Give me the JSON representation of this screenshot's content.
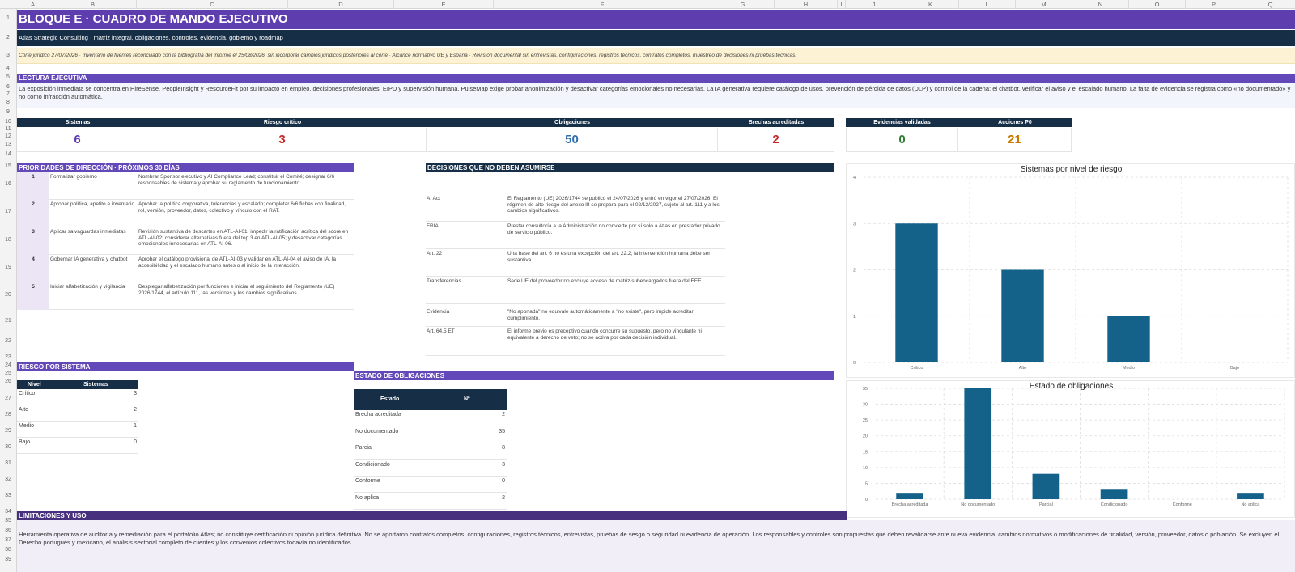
{
  "sheet": {
    "columns": [
      "A",
      "B",
      "C",
      "D",
      "E",
      "F",
      "G",
      "H",
      "I",
      "J",
      "K",
      "L",
      "M",
      "N",
      "O",
      "P",
      "Q"
    ],
    "rows": [
      "1",
      "2",
      "3",
      "4",
      "5",
      "6",
      "7",
      "8",
      "9",
      "10",
      "11",
      "12",
      "13",
      "14",
      "15",
      "16",
      "17",
      "18",
      "19",
      "20",
      "21",
      "22",
      "23",
      "24",
      "25",
      "26",
      "27",
      "28",
      "29",
      "30",
      "31",
      "32",
      "33",
      "34",
      "35",
      "36",
      "37",
      "38",
      "39"
    ]
  },
  "header": {
    "title": "BLOQUE E · CUADRO DE MANDO EJECUTIVO",
    "subtitle": "Atlas Strategic Consulting · matriz integral, obligaciones, controles, evidencia, gobierno y roadmap",
    "note": "Corte jurídico 27/07/2026 · Inventario de fuentes reconciliado con la bibliografía del informe el 25/08/2026, sin incorporar cambios jurídicos posteriores al corte · Alcance normativo UE y España · Revisión documental sin entrevistas, configuraciones, registros técnicos, contratos completos, muestreo de decisiones ni pruebas técnicas."
  },
  "lectura": {
    "title": "LECTURA EJECUTIVA",
    "text": "La exposición inmediata se concentra en HireSense, PeopleInsight y ResourceFit por su impacto en empleo, decisiones profesionales, EIPD y supervisión humana. PulseMap exige probar anonimización y desactivar categorías emocionales no necesarias. La IA generativa requiere catálogo de usos, prevención de pérdida de datos (DLP) y control de la cadena; el chatbot, verificar el aviso y el escalado humano. La falta de evidencia se registra como «no documentado» y no como infracción automática."
  },
  "kpis": [
    {
      "label": "Sistemas",
      "value": "6",
      "color": "#5e3eaf"
    },
    {
      "label": "Riesgo crítico",
      "value": "3",
      "color": "#c62828"
    },
    {
      "label": "Obligaciones",
      "value": "50",
      "color": "#2f6fad"
    },
    {
      "label": "Brechas acreditadas",
      "value": "2",
      "color": "#c62828"
    },
    {
      "label": "Evidencias validadas",
      "value": "0",
      "color": "#2e7d32"
    },
    {
      "label": "Acciones P0",
      "value": "21",
      "color": "#c67a00"
    }
  ],
  "prioridades": {
    "title": "PRIORIDADES DE DIRECCIÓN · PRÓXIMOS 30 DÍAS",
    "items": [
      {
        "n": "1",
        "title": "Formalizar gobierno",
        "desc": "Nombrar Sponsor ejecutivo y AI Compliance Lead; constituir el Comité; designar 6/6 responsables de sistema y aprobar su reglamento de funcionamiento."
      },
      {
        "n": "2",
        "title": "Aprobar política, apetito e inventario",
        "desc": "Aprobar la política corporativa, tolerancias y escalado; completar 6/6 fichas con finalidad, rol, versión, proveedor, datos, colectivo y vínculo con el RAT."
      },
      {
        "n": "3",
        "title": "Aplicar salvaguardas inmediatas",
        "desc": "Revisión sustantiva de descartes en ATL-AI-01; impedir la ratificación acrítica del score en ATL-AI-02; considerar alternativas fuera del top 3 en ATL-AI-05; y desactivar categorías emocionales innecesarias en ATL-AI-06."
      },
      {
        "n": "4",
        "title": "Gobernar IA generativa y chatbot",
        "desc": "Aprobar el catálogo provisional de ATL-AI-03 y validar en ATL-AI-04 el aviso de IA, la accesibilidad y el escalado humano antes o al inicio de la interacción."
      },
      {
        "n": "5",
        "title": "Iniciar alfabetización y vigilancia",
        "desc": "Desplegar alfabetización por funciones e iniciar el seguimiento del Reglamento (UE) 2026/1744, el artículo 111, las versiones y los cambios significativos."
      }
    ]
  },
  "decisiones": {
    "title": "DECISIONES QUE NO DEBEN ASUMIRSE",
    "items": [
      {
        "k": "AI Act",
        "v": "El Reglamento (UE) 2026/1744 se publicó el 24/07/2026 y entró en vigor el 27/07/2026. El régimen de alto riesgo del anexo III se prepara para el 02/12/2027, sujeto al art. 111 y a los cambios significativos."
      },
      {
        "k": "FRIA",
        "v": "Prestar consultoría a la Administración no convierte por sí solo a Atlas en prestador privado de servicio público."
      },
      {
        "k": "Art. 22",
        "v": "Una base del art. 6 no es una excepción del art. 22.2; la intervención humana debe ser sustantiva."
      },
      {
        "k": "Transferencias",
        "v": "Sede UE del proveedor no excluye acceso de matriz/subencargados fuera del EEE."
      },
      {
        "k": "Evidencia",
        "v": "\"No aportada\" no equivale automáticamente a \"no existe\", pero impide acreditar cumplimiento."
      },
      {
        "k": "Art. 64.5 ET",
        "v": "El informe previo es preceptivo cuando concurre su supuesto, pero no vinculante ni equivalente a derecho de veto; no se activa por cada decisión individual."
      }
    ]
  },
  "riesgo": {
    "title": "RIESGO POR SISTEMA",
    "col1": "Nivel",
    "col2": "Sistemas",
    "rows": [
      {
        "label": "Crítico",
        "value": "3"
      },
      {
        "label": "Alto",
        "value": "2"
      },
      {
        "label": "Medio",
        "value": "1"
      },
      {
        "label": "Bajo",
        "value": "0"
      }
    ]
  },
  "obligaciones": {
    "title": "ESTADO DE OBLIGACIONES",
    "col1": "Estado",
    "col2": "Nº",
    "rows": [
      {
        "label": "Brecha acreditada",
        "value": "2"
      },
      {
        "label": "No documentado",
        "value": "35"
      },
      {
        "label": "Parcial",
        "value": "8"
      },
      {
        "label": "Condicionado",
        "value": "3"
      },
      {
        "label": "Conforme",
        "value": "0"
      },
      {
        "label": "No aplica",
        "value": "2"
      }
    ]
  },
  "limitaciones": {
    "title": "LIMITACIONES Y USO",
    "text": "Herramienta operativa de auditoría y remediación para el portafolio Atlas; no constituye certificación ni opinión jurídica definitiva. No se aportaron contratos completos, configuraciones, registros técnicos, entrevistas, pruebas de sesgo o seguridad ni evidencia de operación. Los responsables y controles son propuestas que deben revalidarse ante nueva evidencia, cambios normativos o modificaciones de finalidad, versión, proveedor, datos o población. Se excluyen el Derecho portugués y mexicano, el análisis sectorial completo de clientes y los convenios colectivos todavía no identificados."
  },
  "chart_data": [
    {
      "type": "bar",
      "title": "Sistemas por nivel de riesgo",
      "categories": [
        "Crítico",
        "Alto",
        "Medio",
        "Bajo"
      ],
      "values": [
        3,
        2,
        1,
        0
      ],
      "ylim": [
        0,
        4
      ],
      "yticks": [
        "0",
        "1",
        "2",
        "3",
        "4"
      ],
      "color": "#14628a",
      "grid": true
    },
    {
      "type": "bar",
      "title": "Estado de obligaciones",
      "categories": [
        "Brecha acreditada",
        "No documentado",
        "Parcial",
        "Condicionado",
        "Conforme",
        "No aplica"
      ],
      "values": [
        2,
        35,
        8,
        3,
        0,
        2
      ],
      "ylim": [
        0,
        35
      ],
      "yticks": [
        "0",
        "5",
        "10",
        "15",
        "20",
        "25",
        "30",
        "35"
      ],
      "color": "#14628a",
      "grid": true
    }
  ]
}
